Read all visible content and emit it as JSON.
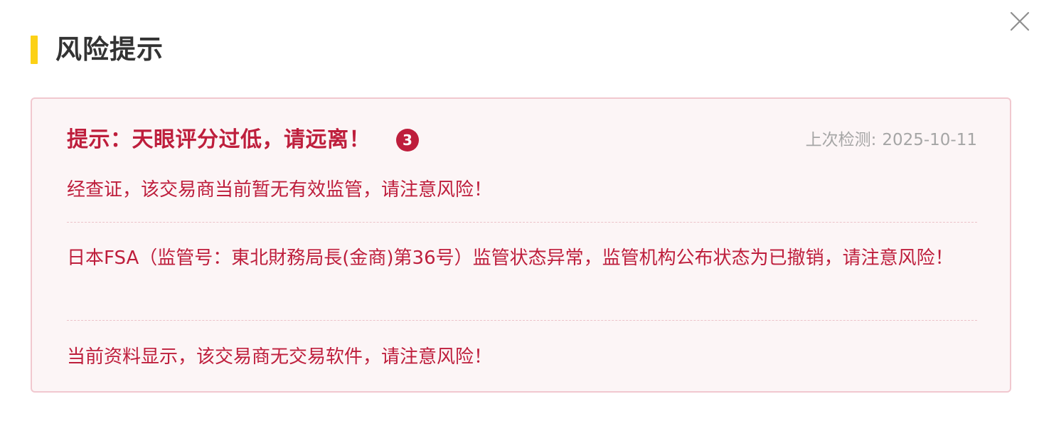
{
  "dialog": {
    "title": "风险提示",
    "close_icon": "close-icon"
  },
  "risk_card": {
    "headline": "提示：天眼评分过低，请远离！",
    "badge_count": "3",
    "last_check_label": "上次检测:",
    "last_check_date": "2025-10-11",
    "messages": [
      "经查证，该交易商当前暂无有效监管，请注意风险！",
      "日本FSA（监管号：東北財務局長(金商)第36号）监管状态异常，监管机构公布状态为已撤销，请注意风险！",
      "当前资料显示，该交易商无交易软件，请注意风险！"
    ]
  },
  "colors": {
    "accent_bar": "#fcd116",
    "risk_red": "#be1e3c",
    "card_bg": "#fcf5f6",
    "card_border": "#f1c8cf",
    "muted_text": "#a5a5a5",
    "title_text": "#333333"
  }
}
